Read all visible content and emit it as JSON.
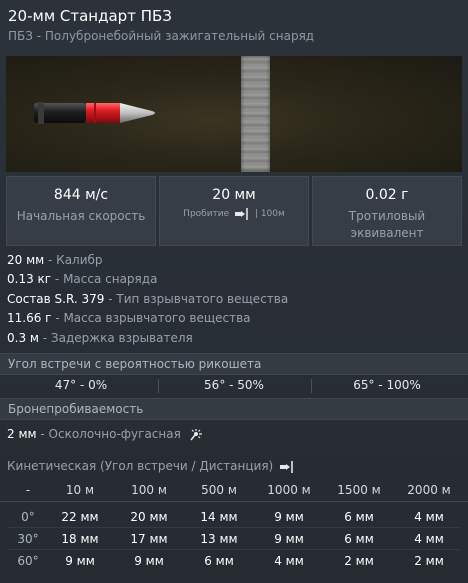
{
  "header": {
    "title": "20-мм Стандарт ПБЗ",
    "subtitle": "ПБЗ - Полубронебойный зажигательный снаряд"
  },
  "stats": {
    "velocity": {
      "value": "844 м/с",
      "label": "Начальная скорость"
    },
    "penetration": {
      "value": "20 мм",
      "label": "Пробитие",
      "range": "| 100м"
    },
    "tnt": {
      "value": "0.02 г",
      "label": "Тротиловый эквивалент"
    }
  },
  "properties": [
    {
      "value": "20 мм",
      "name": "- Калибр"
    },
    {
      "value": "0.13 кг",
      "name": "- Масса снаряда"
    },
    {
      "value": "Состав S.R. 379",
      "name": "- Тип взрывчатого вещества"
    },
    {
      "value": "11.66 г",
      "name": "- Масса взрывчатого вещества"
    },
    {
      "value": "0.3 м",
      "name": "- Задержка взрывателя"
    }
  ],
  "ricochet": {
    "title": "Угол встречи с вероятностью рикошета",
    "items": [
      "47° - 0%",
      "56° - 50%",
      "65° - 100%"
    ]
  },
  "armor": {
    "title": "Бронепробиваемость",
    "he_value": "2 мм",
    "he_label": "- Осколочно-фугасная",
    "kinetic_title": "Кинетическая (Угол встречи / Дистанция)",
    "corner": "-",
    "distances": [
      "10 м",
      "100 м",
      "500 м",
      "1000 м",
      "1500 м",
      "2000 м"
    ],
    "rows": [
      {
        "angle": "0°",
        "values": [
          "22 мм",
          "20 мм",
          "14 мм",
          "9 мм",
          "6 мм",
          "4 мм"
        ]
      },
      {
        "angle": "30°",
        "values": [
          "18 мм",
          "17 мм",
          "13 мм",
          "9 мм",
          "6 мм",
          "4 мм"
        ]
      },
      {
        "angle": "60°",
        "values": [
          "9 мм",
          "9 мм",
          "6 мм",
          "4 мм",
          "2 мм",
          "2 мм"
        ]
      }
    ]
  },
  "colors": {
    "background": "#2a3038",
    "shell_red": "#d01a22",
    "plate": "#8e8e8c"
  },
  "icons": {
    "penetration": "penetration-icon",
    "he": "burst-icon",
    "kinetic": "penetration-icon"
  }
}
